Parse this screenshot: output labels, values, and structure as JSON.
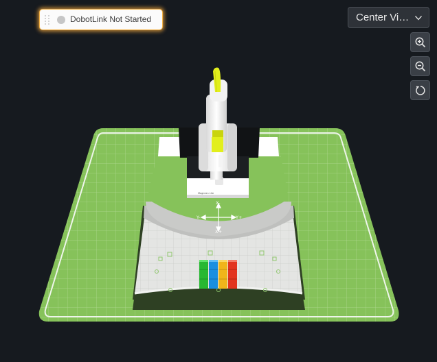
{
  "status": {
    "label": "DobotLink Not Started",
    "state": "not-started",
    "dot_color": "#c6c6c6"
  },
  "view_select": {
    "value": "Center View"
  },
  "toolbar": [
    {
      "name": "zoom-in",
      "icon": "zoom-in-icon"
    },
    {
      "name": "zoom-out",
      "icon": "zoom-out-icon"
    },
    {
      "name": "reset-view",
      "icon": "reset-icon"
    }
  ],
  "scene": {
    "axis_labels": {
      "x_minus": "X-",
      "x_plus": "X+",
      "y_minus": "Y-",
      "y_plus": "Y+"
    },
    "robot_label": "Magician Lite",
    "block_colors": [
      "#2fcc3a",
      "#1a9be8",
      "#f4c21a",
      "#ea3a24"
    ],
    "colors": {
      "background": "#161a1f",
      "mat_green": "#86c25a",
      "mat_border": "#eef5ea",
      "accent_yellow": "#e2ef1c",
      "status_glow": "#f2b247"
    }
  }
}
